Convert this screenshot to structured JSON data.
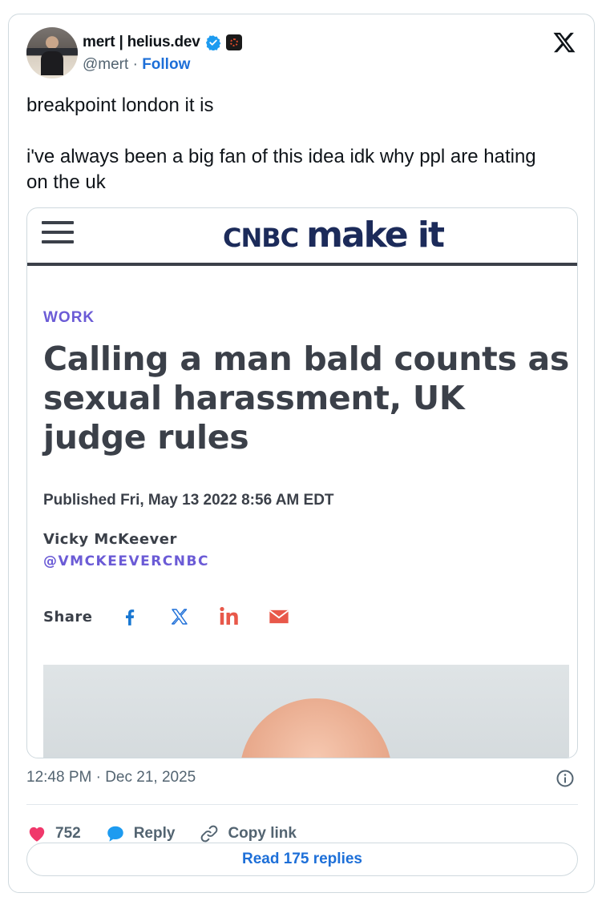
{
  "author": {
    "name": "mert | helius.dev",
    "handle": "@mert",
    "separator": "·",
    "follow_label": "Follow"
  },
  "tweet": {
    "line1": "breakpoint london it is",
    "line2": "i've always been a big fan of this idea idk why ppl are hating on the uk",
    "timestamp": "12:48 PM · Dec 21, 2025"
  },
  "article": {
    "logo_cnbc": "CNBC",
    "logo_makeit": "make it",
    "section": "WORK",
    "headline": "Calling a man bald counts as sexual harassment, UK judge rules",
    "published": "Published Fri, May 13 2022 8:56 AM EDT",
    "author": "Vicky McKeever",
    "author_handle": "@VMCKEEVERCNBC",
    "share_label": "Share",
    "share_icons": [
      "facebook-icon",
      "x-icon",
      "linkedin-icon",
      "email-icon"
    ]
  },
  "actions": {
    "likes": "752",
    "reply_label": "Reply",
    "copy_link_label": "Copy link",
    "read_replies_label": "Read 175 replies"
  },
  "colors": {
    "like": "#f0386b",
    "reply": "#1d9bf0",
    "link_blue": "#1d6fd8",
    "cnbc_purple": "#6b5bd6",
    "cnbc_navy": "#1c2b5a",
    "linkedin_red": "#e8584a"
  }
}
